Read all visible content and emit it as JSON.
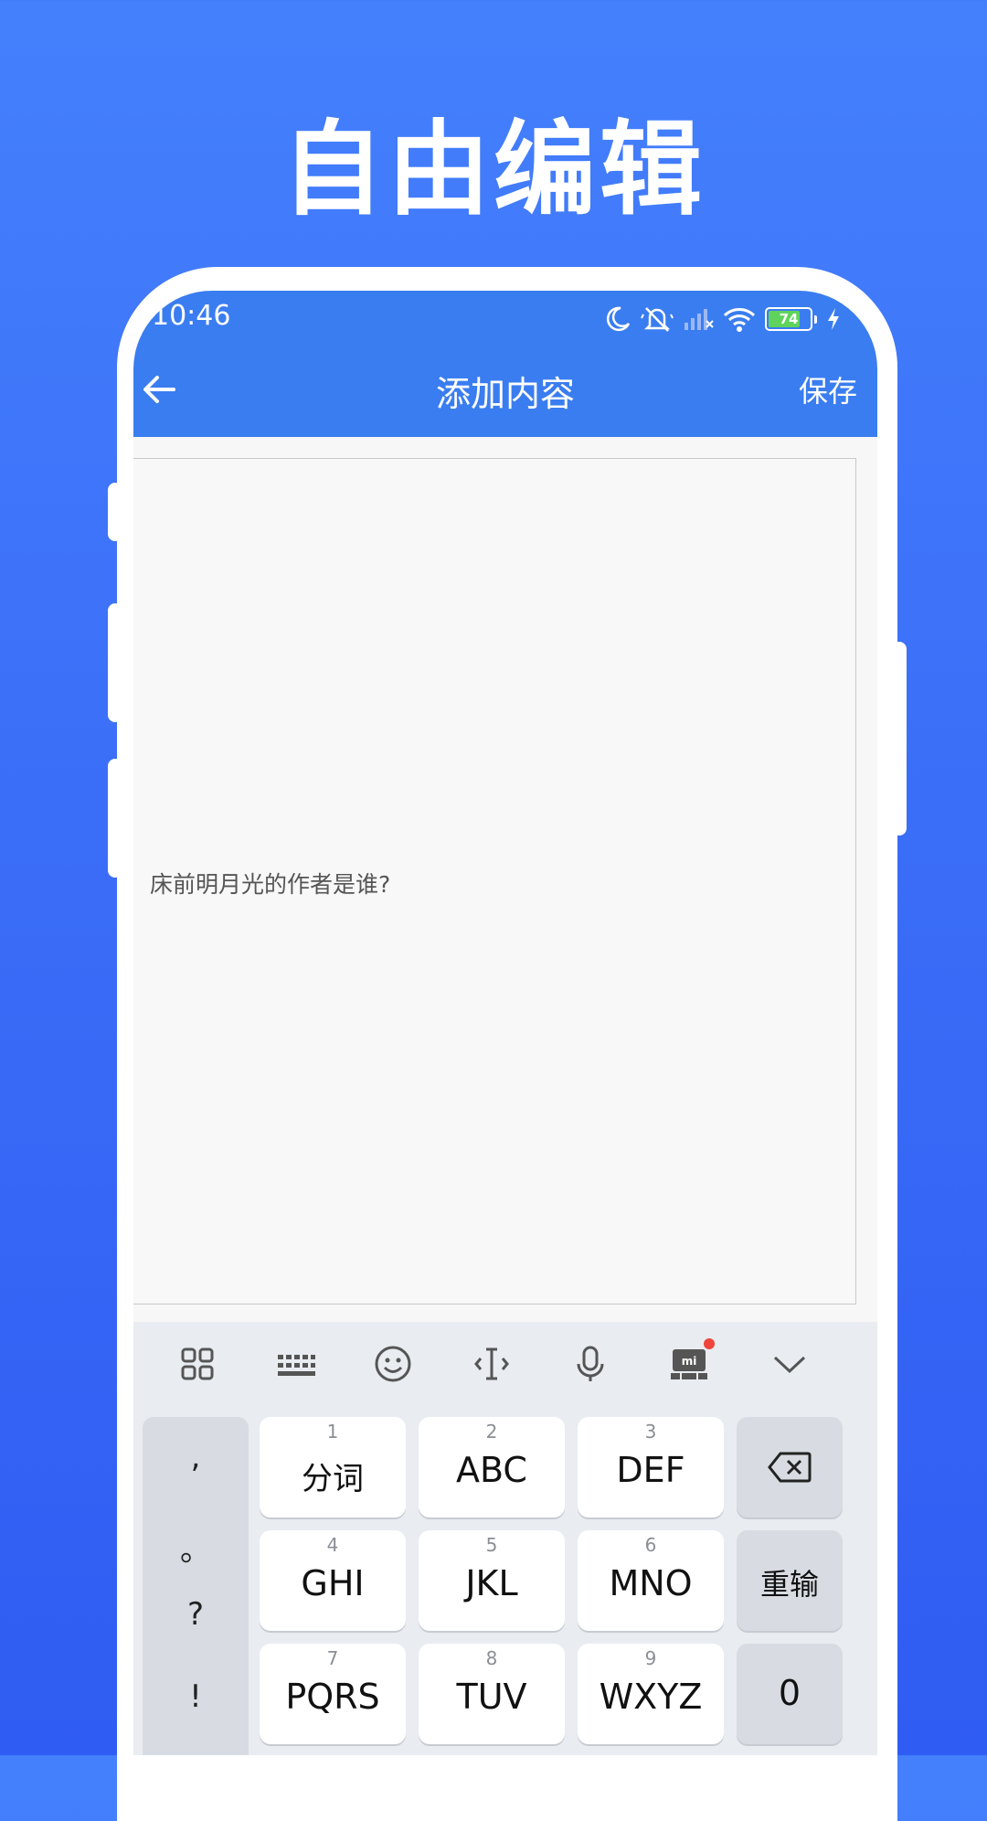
{
  "headline": "自由编辑",
  "status_bar": {
    "time": "10:46",
    "battery": "74",
    "icons": [
      "moon-icon",
      "mute-icon",
      "signal-icon",
      "wifi-icon",
      "battery-icon",
      "charging-icon"
    ]
  },
  "app_bar": {
    "title": "添加内容",
    "save_label": "保存",
    "back_icon": "arrow-left-icon"
  },
  "editor": {
    "value": "床前明月光的作者是谁?"
  },
  "keyboard": {
    "toolbar": [
      "grid-icon",
      "keyboard-icon",
      "emoji-icon",
      "cursor-icon",
      "microphone-icon",
      "mi-keyboard-icon",
      "chevron-down-icon"
    ],
    "punctuation": [
      ",",
      "。",
      "?",
      "!"
    ],
    "keys": [
      {
        "num": "1",
        "label": "分词"
      },
      {
        "num": "2",
        "label": "ABC"
      },
      {
        "num": "3",
        "label": "DEF"
      },
      {
        "num": "4",
        "label": "GHI"
      },
      {
        "num": "5",
        "label": "JKL"
      },
      {
        "num": "6",
        "label": "MNO"
      },
      {
        "num": "7",
        "label": "PQRS"
      },
      {
        "num": "8",
        "label": "TUV"
      },
      {
        "num": "9",
        "label": "WXYZ"
      }
    ],
    "reenter_label": "重输",
    "zero_label": "0",
    "backspace_icon": "backspace-icon"
  },
  "colors": {
    "background": "#3b6ef8",
    "app_bar": "#3a7df0",
    "notification_dot": "#f0443d"
  }
}
